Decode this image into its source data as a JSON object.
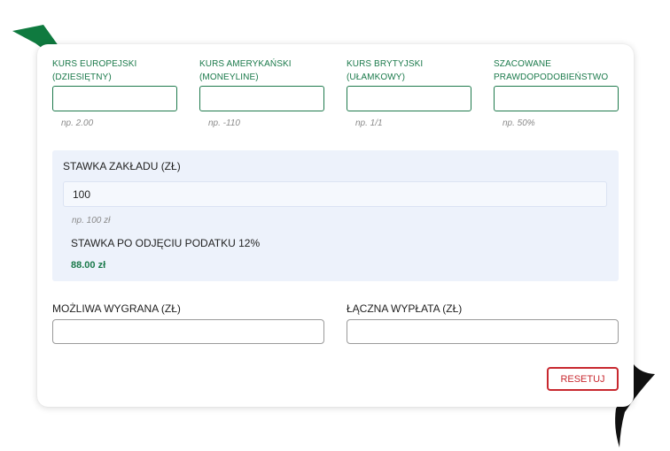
{
  "odds": [
    {
      "label": "KURS EUROPEJSKI (DZIESIĘTNY)",
      "value": "",
      "hint": "np. 2.00"
    },
    {
      "label": "KURS AMERYKAŃSKI (MONEYLINE)",
      "value": "",
      "hint": "np. -110"
    },
    {
      "label": "KURS BRYTYJSKI (UŁAMKOWY)",
      "value": "",
      "hint": "np. 1/1"
    },
    {
      "label": "SZACOWANE PRAWDOPODOBIEŃSTWO",
      "value": "",
      "hint": "np. 50%"
    }
  ],
  "stake": {
    "label": "STAWKA ZAKŁADU (ZŁ)",
    "value": "100",
    "hint": "np. 100 zł",
    "after_tax_label": "STAWKA PO ODJĘCIU PODATKU 12%",
    "after_tax_value": "88.00 zł"
  },
  "results": {
    "possible_win_label": "MOŻLIWA WYGRANA (ZŁ)",
    "possible_win_value": "",
    "total_payout_label": "ŁĄCZNA WYPŁATA (ZŁ)",
    "total_payout_value": ""
  },
  "reset_label": "RESETUJ",
  "colors": {
    "accent_green": "#1b7a4b",
    "panel_bg": "#edf2fb",
    "reset_red": "#c8282f"
  }
}
